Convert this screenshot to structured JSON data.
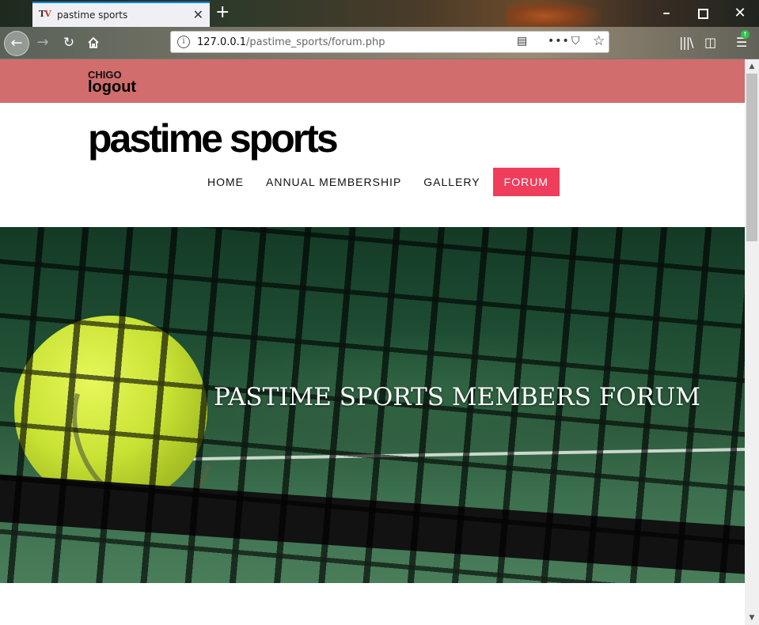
{
  "browser": {
    "tab_title": "pastime sports",
    "url_host": "127.0.0.1",
    "url_path": "/pastime_sports/forum.php"
  },
  "header": {
    "username": "CHIGO",
    "logout_label": "logout",
    "brand": "pastime sports"
  },
  "nav": {
    "items": [
      {
        "label": "HOME"
      },
      {
        "label": "ANNUAL MEMBERSHIP"
      },
      {
        "label": "GALLERY"
      },
      {
        "label": "FORUM"
      }
    ],
    "active": "FORUM"
  },
  "hero": {
    "title": "PASTIME SPORTS MEMBERS FORUM"
  },
  "colors": {
    "top_band": "#d16d6d",
    "active_nav": "#f03d5c"
  }
}
